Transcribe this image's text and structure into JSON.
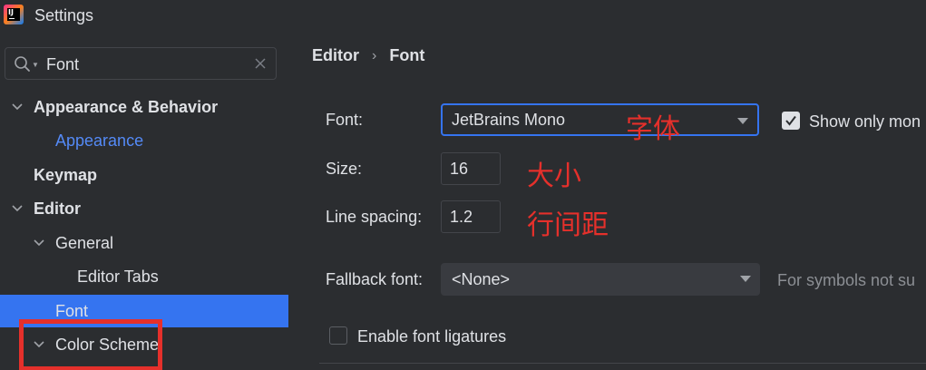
{
  "window": {
    "title": "Settings",
    "app_icon": "intellij-idea-icon"
  },
  "search": {
    "value": "Font",
    "icons": [
      "search-icon",
      "clear-icon"
    ]
  },
  "tree": [
    {
      "label": "Appearance & Behavior",
      "expanded": true
    },
    {
      "label": "Appearance"
    },
    {
      "label": "Keymap"
    },
    {
      "label": "Editor",
      "expanded": true
    },
    {
      "label": "General",
      "expanded": true
    },
    {
      "label": "Editor Tabs"
    },
    {
      "label": "Font",
      "selected": true
    },
    {
      "label": "Color Scheme",
      "expanded": false
    }
  ],
  "breadcrumb": {
    "parent": "Editor",
    "separator": "›",
    "current": "Font"
  },
  "form": {
    "font_label": "Font:",
    "font_value": "JetBrains Mono",
    "show_only_mono_label": "Show only mon",
    "show_only_mono_checked": true,
    "size_label": "Size:",
    "size_value": "16",
    "line_spacing_label": "Line spacing:",
    "line_spacing_value": "1.2",
    "fallback_label": "Fallback font:",
    "fallback_value": "<None>",
    "fallback_hint": "For symbols not su",
    "ligatures_label": "Enable font ligatures",
    "ligatures_checked": false
  },
  "annotations": {
    "font": "字体",
    "size": "大小",
    "line_spacing": "行间距"
  },
  "colors": {
    "accent": "#3574f0",
    "annotation": "#e5302b",
    "link": "#548af7",
    "background": "#2b2d30"
  }
}
